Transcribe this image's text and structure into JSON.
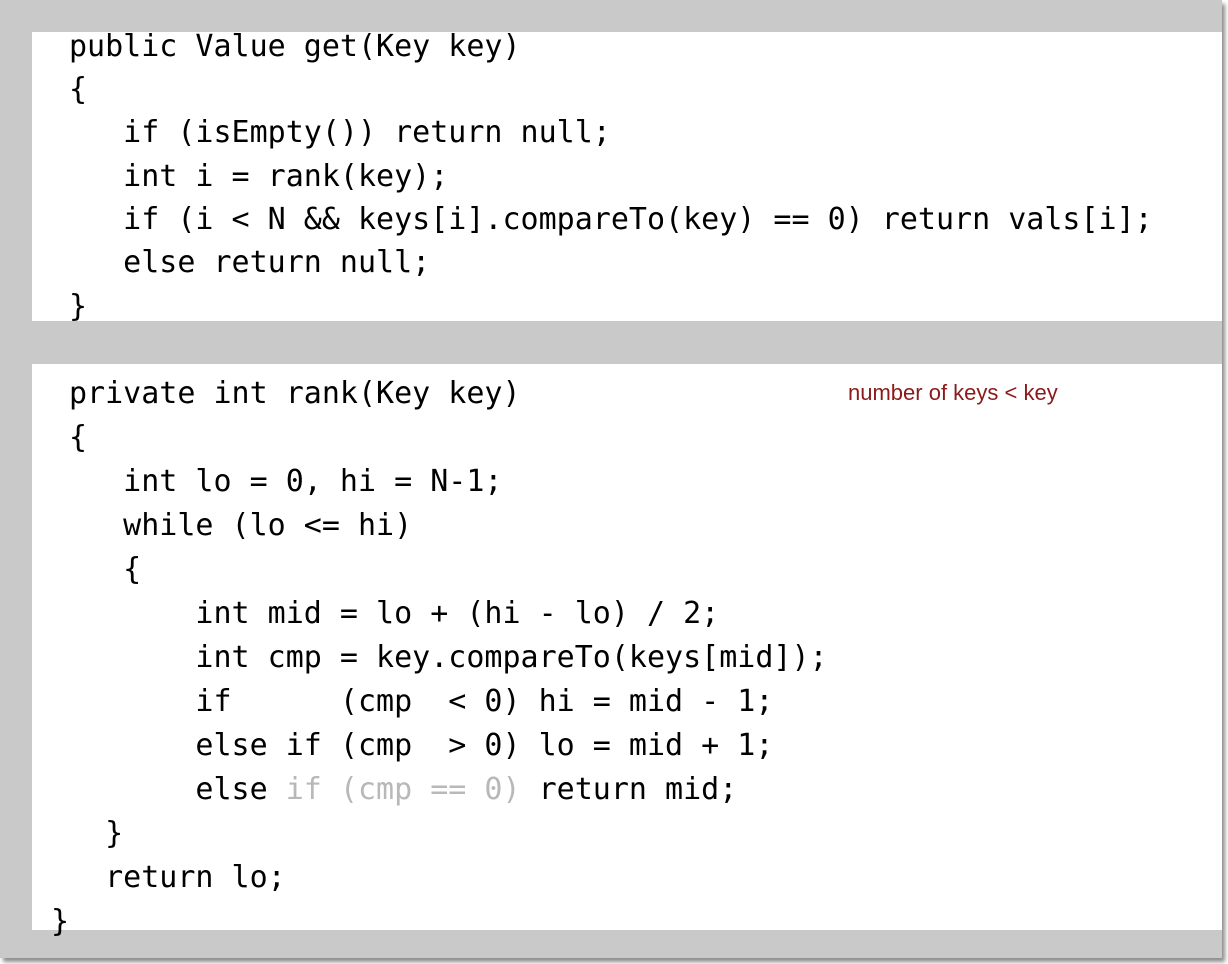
{
  "get_method": {
    "lines": [
      "public Value get(Key key)",
      "{",
      "   if (isEmpty()) return null;",
      "   int i = rank(key);",
      "   if (i < N && keys[i].compareTo(key) == 0) return vals[i];",
      "   else return null;",
      "}"
    ]
  },
  "rank_method": {
    "annotation": "number of keys < key",
    "lines": [
      "private int rank(Key key)",
      "{",
      "   int lo = 0, hi = N-1;",
      "   while (lo <= hi)",
      "   {",
      "       int mid = lo + (hi - lo) / 2;",
      "       int cmp = key.compareTo(keys[mid]);",
      "       if      (cmp  < 0) hi = mid - 1;",
      "       else if (cmp  > 0) lo = mid + 1;",
      "       else ",
      "  }",
      "  return lo;",
      "}"
    ],
    "faded_fragment": "if (cmp == 0)",
    "return_mid": " return mid;"
  },
  "colors": {
    "panel_background": "#ffffff",
    "frame_background": "#c9c9c9",
    "annotation": "#8b1a1a",
    "faded_code": "#b8b8b8"
  }
}
